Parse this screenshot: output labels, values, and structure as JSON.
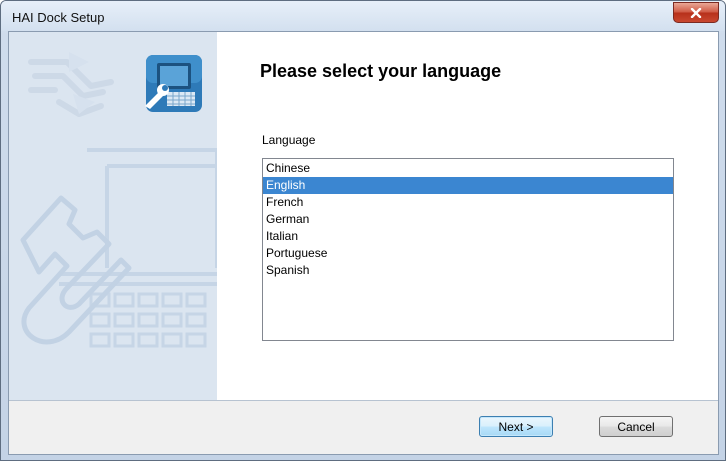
{
  "window": {
    "title": "HAI Dock Setup",
    "close_icon": "close-x-icon"
  },
  "side_panel": {
    "illustration": "wrench-laptop-illustration",
    "logo_icon": "dock-setup-logo-icon"
  },
  "main": {
    "heading": "Please select your language",
    "language_label": "Language",
    "languages": [
      "Chinese",
      "English",
      "French",
      "German",
      "Italian",
      "Portuguese",
      "Spanish"
    ],
    "selected_language": "English"
  },
  "footer": {
    "next_label": "Next >",
    "cancel_label": "Cancel"
  },
  "colors": {
    "selection": "#3b86d1",
    "side_panel_bg": "#dbe5f0",
    "close_button": "#c9482f"
  }
}
